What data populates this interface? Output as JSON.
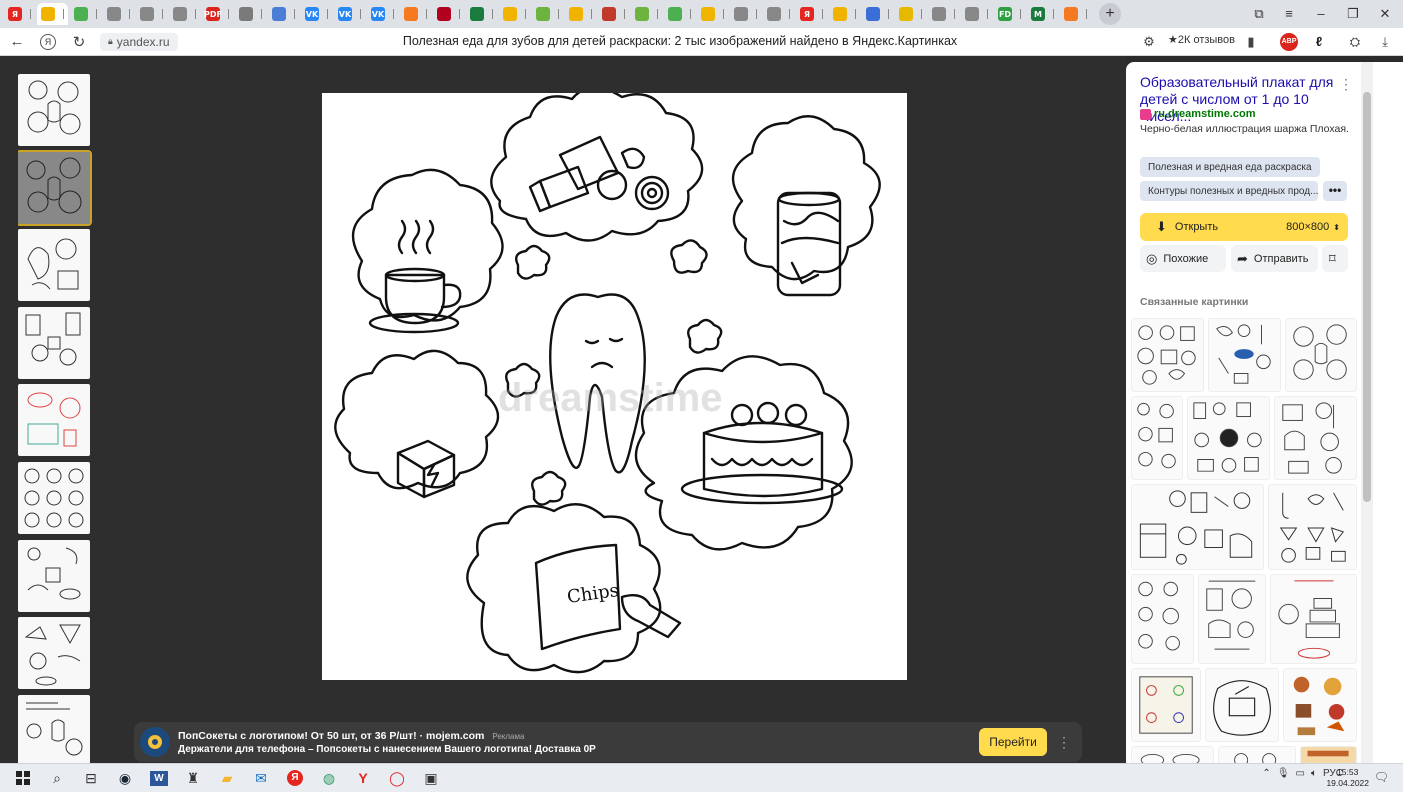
{
  "browser": {
    "tabs": [
      {
        "label": "Я",
        "color": "#e52620",
        "active": false
      },
      {
        "label": "",
        "color": "#f0b400",
        "active": true
      },
      {
        "label": "",
        "color": "#4caf50",
        "active": false
      },
      {
        "label": "",
        "color": "#888888",
        "active": false
      },
      {
        "label": "",
        "color": "#888888",
        "active": false
      },
      {
        "label": "",
        "color": "#888888",
        "active": false
      },
      {
        "label": "PDF",
        "color": "#d9251c",
        "active": false
      },
      {
        "label": "",
        "color": "#7a7a7a",
        "active": false
      },
      {
        "label": "",
        "color": "#4a7ed6",
        "active": false
      },
      {
        "label": "VK",
        "color": "#2787f5",
        "active": false
      },
      {
        "label": "VK",
        "color": "#2787f5",
        "active": false
      },
      {
        "label": "VK",
        "color": "#2787f5",
        "active": false
      },
      {
        "label": "",
        "color": "#f47920",
        "active": false
      },
      {
        "label": "",
        "color": "#b2001f",
        "active": false
      },
      {
        "label": "",
        "color": "#1b7a3d",
        "active": false
      },
      {
        "label": "",
        "color": "#f0b400",
        "active": false
      },
      {
        "label": "",
        "color": "#6db33f",
        "active": false
      },
      {
        "label": "",
        "color": "#f0b400",
        "active": false
      },
      {
        "label": "",
        "color": "#c0392b",
        "active": false
      },
      {
        "label": "",
        "color": "#6db33f",
        "active": false
      },
      {
        "label": "",
        "color": "#4caf50",
        "active": false
      },
      {
        "label": "",
        "color": "#f0b400",
        "active": false
      },
      {
        "label": "",
        "color": "#888888",
        "active": false
      },
      {
        "label": "",
        "color": "#888888",
        "active": false
      },
      {
        "label": "Я",
        "color": "#e52620",
        "active": false
      },
      {
        "label": "",
        "color": "#f0b400",
        "active": false
      },
      {
        "label": "",
        "color": "#3b6fd8",
        "active": false
      },
      {
        "label": "",
        "color": "#e6b800",
        "active": false
      },
      {
        "label": "",
        "color": "#888888",
        "active": false
      },
      {
        "label": "",
        "color": "#888888",
        "active": false
      },
      {
        "label": "FD",
        "color": "#2ea043",
        "active": false
      },
      {
        "label": "M",
        "color": "#1b7a3d",
        "active": false
      },
      {
        "label": "",
        "color": "#f47920",
        "active": false
      }
    ],
    "new_tab": "+",
    "domain": "yandex.ru",
    "page_title": "Полезная еда для зубов для детей раскраски: 2 тыс изображений найдено в Яндекс.Картинках",
    "reviews": "★2К отзывов",
    "abp": "ABP",
    "controls": {
      "minimize": "–",
      "maximize": "❐",
      "close": "✕",
      "menu": "≡",
      "bookmarks": "⧉"
    }
  },
  "viewer": {
    "watermark": "dreamstime",
    "close": "✕",
    "image_labels": {
      "chips_text": "Chips"
    }
  },
  "ad": {
    "title": "ПопСокеты с логотипом! От 50 шт, от 36 Р/шт! · mojem.com",
    "badge": "Реклама",
    "description": "Держатели для телефона – Попсокеты с нанесением Вашего логотипа! Доставка 0Р",
    "button": "Перейти",
    "more": "⋮"
  },
  "sidebar": {
    "title": "Образовательный плакат для детей с числом от 1 до 10 Чисел...",
    "source": "ru.dreamstime.com",
    "description": "Черно-белая иллюстрация шаржа Плохая...",
    "chips": [
      "Полезная и вредная еда раскраска",
      "Контуры полезных и вредных прод..."
    ],
    "chip_more": "•••",
    "open_label": "Открыть",
    "open_size": "800×800",
    "similar_label": "Похожие",
    "send_label": "Отправить",
    "related_header": "Связанные картинки",
    "accent": "#ffdb4d"
  },
  "taskbar": {
    "lang": "РУС",
    "time": "15:53",
    "date": "19.04.2022"
  }
}
